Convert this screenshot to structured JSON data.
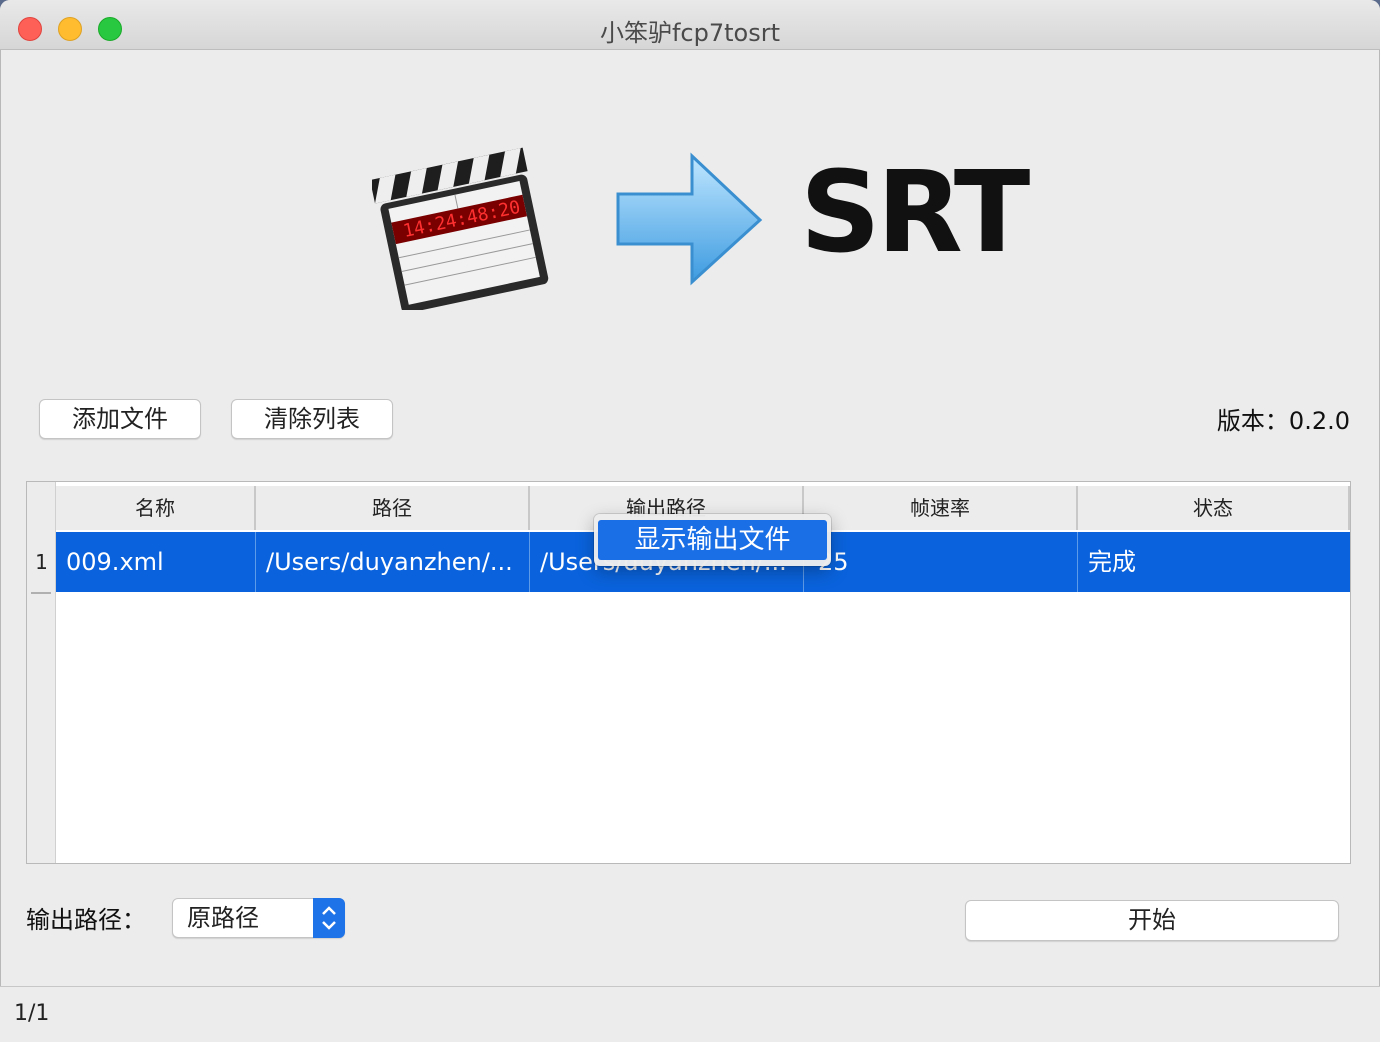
{
  "window": {
    "title": "小笨驴fcp7tosrt"
  },
  "banner": {
    "logo_text": "SRT",
    "icons": [
      "clapperboard-icon",
      "arrow-right-icon"
    ]
  },
  "toolbar": {
    "add_files_label": "添加文件",
    "clear_list_label": "清除列表",
    "version_text": "版本：0.2.0"
  },
  "table": {
    "columns": [
      "名称",
      "路径",
      "输出路径",
      "帧速率",
      "状态"
    ],
    "rows": [
      {
        "index": "1",
        "name": "009.xml",
        "path": "/Users/duyanzhen/...",
        "output_path": "/Users/duyanzhen/...",
        "frame_rate": "25",
        "status": "完成"
      }
    ]
  },
  "context_menu": {
    "items": [
      "显示输出文件"
    ]
  },
  "output": {
    "label": "输出路径：",
    "selected": "原路径"
  },
  "actions": {
    "start_label": "开始"
  },
  "status_bar": {
    "text": "1/1"
  },
  "colors": {
    "selection": "#0a63dd",
    "menu_highlight": "#1a6ee6",
    "select_accent": "#1e73e8"
  }
}
